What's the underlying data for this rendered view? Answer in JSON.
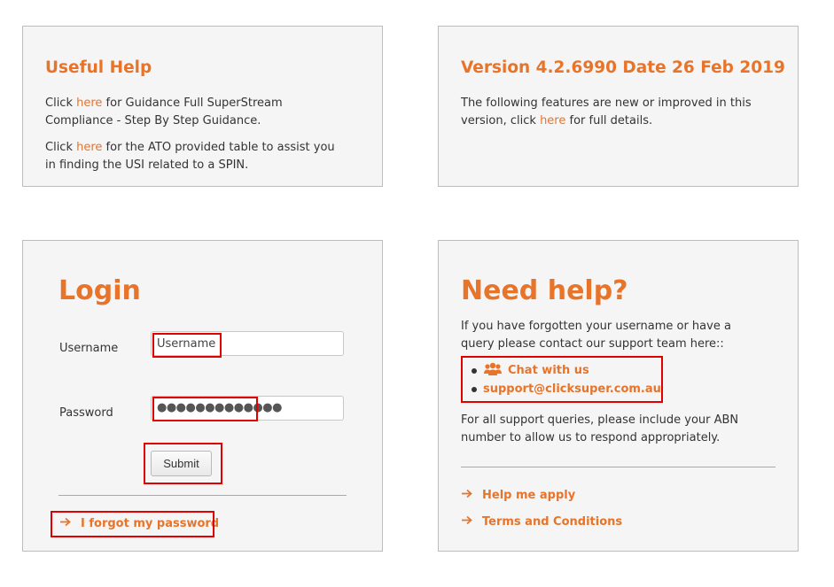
{
  "useful_help": {
    "title": "Useful Help",
    "p1_pre": "Click ",
    "p1_link": "here",
    "p1_post": " for Guidance Full SuperStream Compliance - Step By Step Guidance.",
    "p2_pre": "Click ",
    "p2_link": "here",
    "p2_post": " for the ATO provided table to assist you in finding the USI related to a SPIN."
  },
  "version": {
    "title": "Version 4.2.6990 Date 26 Feb 2019",
    "p_pre": "The following features are new or improved in this version, click ",
    "p_link": "here",
    "p_post": " for full details."
  },
  "login": {
    "title": "Login",
    "username_label": "Username",
    "username_value": "Username",
    "password_label": "Password",
    "password_value": "●●●●●●●●●●●●●",
    "submit_label": "Submit",
    "forgot_label": "I forgot my password"
  },
  "need_help": {
    "title": "Need help?",
    "intro": "If you have forgotten your username or have a query please contact our support team here::",
    "chat_label": "Chat with us",
    "email": "support@clicksuper.com.au",
    "note": "For all support queries, please include your ABN number to allow us to respond appropriately.",
    "help_apply": "Help me apply",
    "terms": "Terms and Conditions"
  },
  "colors": {
    "accent": "#e8742a",
    "highlight": "#e00000"
  }
}
